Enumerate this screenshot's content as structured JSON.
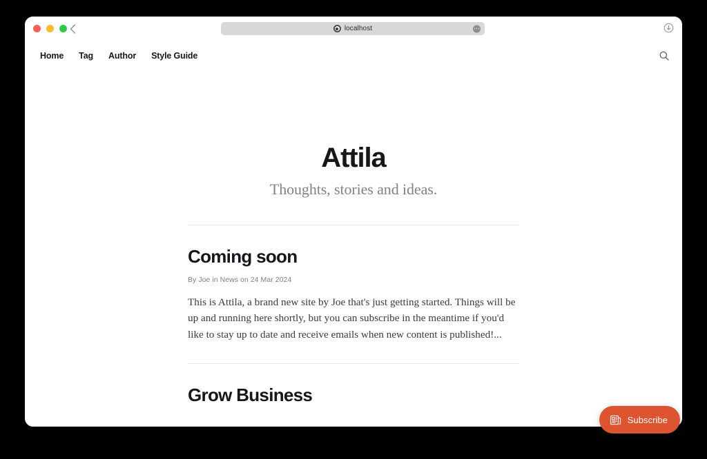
{
  "browser": {
    "traffic_lights": [
      {
        "name": "close",
        "color": "#f95f57"
      },
      {
        "name": "minimize",
        "color": "#fbbd2e"
      },
      {
        "name": "maximize",
        "color": "#31c948"
      }
    ],
    "back_label": "‹",
    "url": "localhost",
    "url_menu_icon": "ellipsis-icon",
    "download_icon": "download-icon",
    "loading_bar_color": "#e2573a"
  },
  "site": {
    "nav": [
      {
        "label": "Home"
      },
      {
        "label": "Tag"
      },
      {
        "label": "Author"
      },
      {
        "label": "Style Guide"
      }
    ],
    "search_icon": "search-icon",
    "title": "Attila",
    "description": "Thoughts, stories and ideas."
  },
  "posts": [
    {
      "title": "Coming soon",
      "meta": "By Joe in News on 24 Mar 2024",
      "excerpt": "This is Attila, a brand new site by Joe that's just getting started. Things will be up and running here shortly, but you can subscribe in the meantime if you'd like to stay up to date and receive emails when new content is published!..."
    },
    {
      "title": "Grow Business",
      "meta": "",
      "excerpt": ""
    }
  ],
  "subscribe": {
    "label": "Subscribe",
    "icon": "newsletter-icon",
    "background": "#df5430"
  }
}
